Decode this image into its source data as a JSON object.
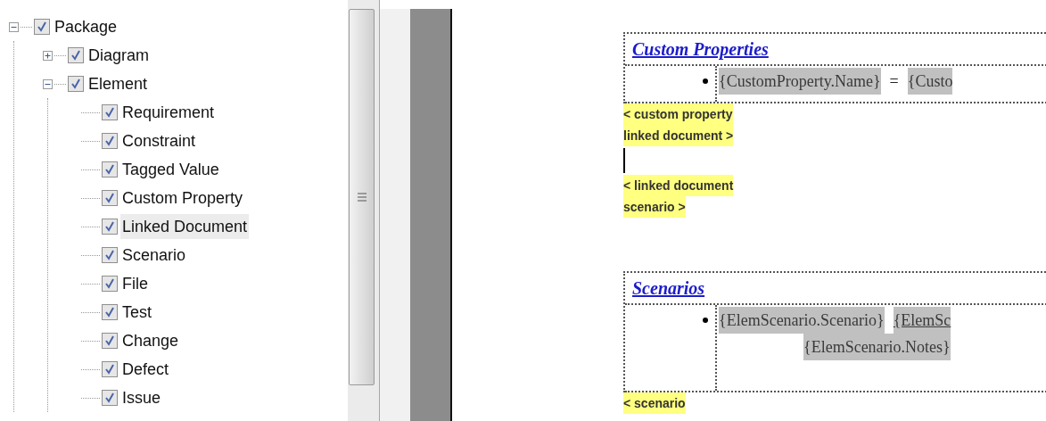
{
  "tree": {
    "label": "Package",
    "checked": true,
    "expanded": true,
    "selected": false,
    "children": [
      {
        "label": "Diagram",
        "checked": true,
        "expanded": false,
        "selected": false
      },
      {
        "label": "Element",
        "checked": true,
        "expanded": true,
        "selected": false,
        "children": [
          {
            "label": "Requirement",
            "checked": true,
            "selected": false
          },
          {
            "label": "Constraint",
            "checked": true,
            "selected": false
          },
          {
            "label": "Tagged Value",
            "checked": true,
            "selected": false
          },
          {
            "label": "Custom Property",
            "checked": true,
            "selected": false
          },
          {
            "label": "Linked Document",
            "checked": true,
            "selected": true
          },
          {
            "label": "Scenario",
            "checked": true,
            "selected": false
          },
          {
            "label": "File",
            "checked": true,
            "selected": false
          },
          {
            "label": "Test",
            "checked": true,
            "selected": false
          },
          {
            "label": "Change",
            "checked": true,
            "selected": false
          },
          {
            "label": "Defect",
            "checked": true,
            "selected": false
          },
          {
            "label": "Issue",
            "checked": true,
            "selected": false
          }
        ]
      }
    ]
  },
  "document": [
    {
      "kind": "table",
      "heading": "Custom Properties",
      "lines": [
        [
          {
            "kind": "field",
            "text": "{CustomProperty.Name}",
            "underlined": false
          },
          {
            "kind": "plain",
            "text": "="
          },
          {
            "kind": "field",
            "text": "{Custo",
            "underlined": false
          }
        ]
      ]
    },
    {
      "kind": "tag",
      "text": "< custom property"
    },
    {
      "kind": "tag",
      "text": "linked document >"
    },
    {
      "kind": "cursor"
    },
    {
      "kind": "tag",
      "text": "< linked document"
    },
    {
      "kind": "tag",
      "text": "scenario >"
    },
    {
      "kind": "table",
      "heading": "Scenarios",
      "lines": [
        [
          {
            "kind": "field",
            "text": "{ElemScenario.Scenario}",
            "underlined": false
          },
          {
            "kind": "field",
            "text": "{ElemSc",
            "underlined": true
          }
        ],
        [
          {
            "kind": "field",
            "text": "{ElemScenario.Notes}",
            "underlined": false
          }
        ]
      ]
    },
    {
      "kind": "tag",
      "text": "< scenario"
    }
  ]
}
